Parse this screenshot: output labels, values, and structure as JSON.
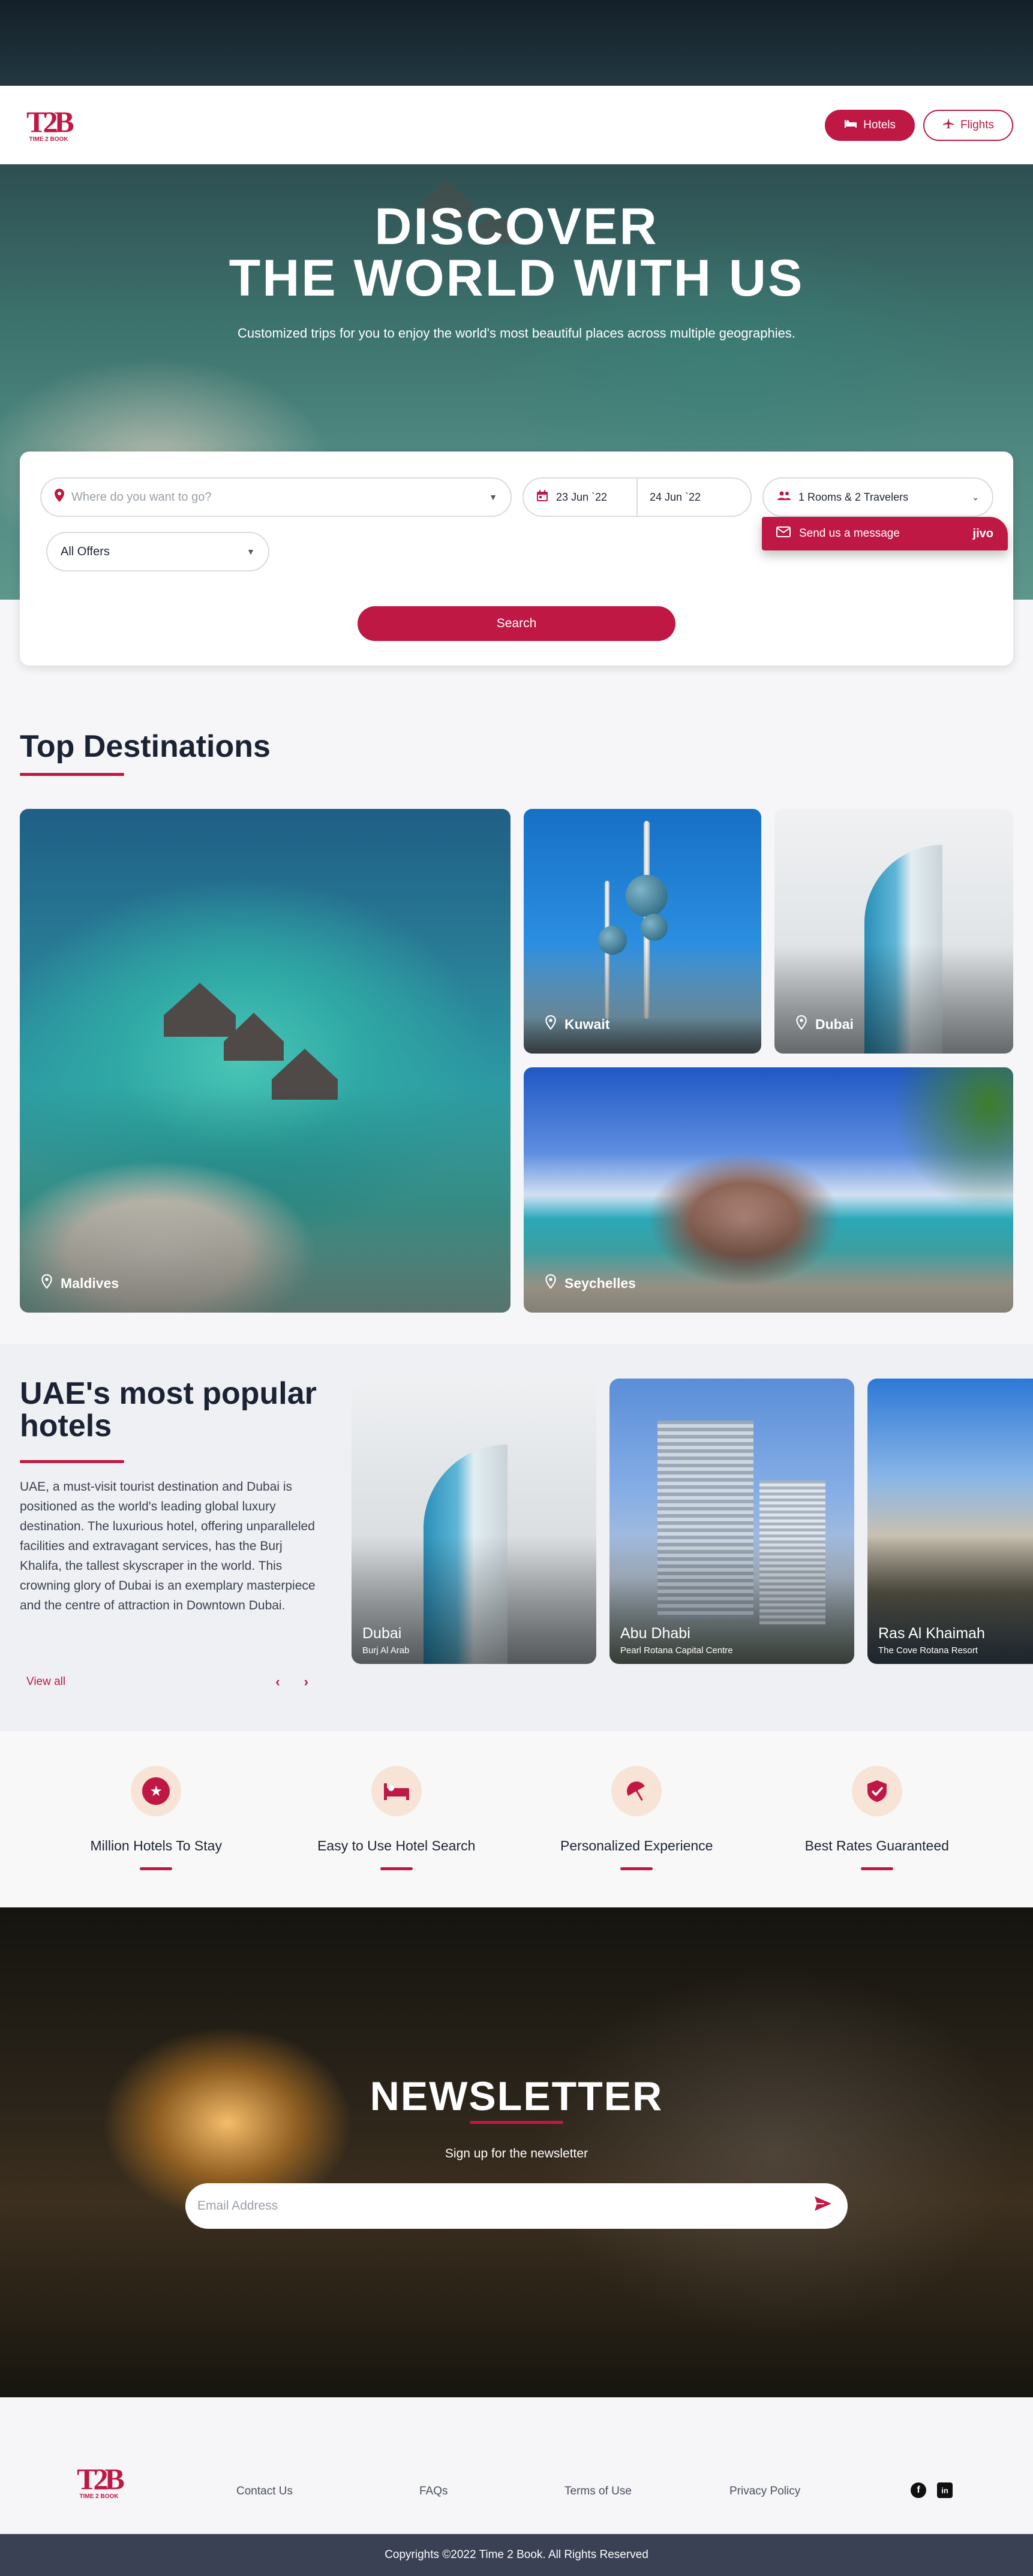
{
  "header": {
    "logo_mark": "T2B",
    "logo_text": "TIME 2 BOOK",
    "nav": [
      {
        "label": "Hotels",
        "icon": "bed-icon"
      },
      {
        "label": "Flights",
        "icon": "plane-icon"
      }
    ]
  },
  "hero": {
    "title_line1": "DISCOVER",
    "title_line2": "THE WORLD WITH US",
    "subtitle": "Customized trips for you to enjoy the world's most beautiful places across multiple geographies."
  },
  "search": {
    "destination_placeholder": "Where do you want to go?",
    "checkin": "23 Jun `22",
    "checkout": "24 Jun `22",
    "travelers": "1 Rooms & 2 Travelers",
    "offers": "All Offers",
    "search_label": "Search"
  },
  "chat": {
    "label": "Send us a message",
    "brand": "jivo"
  },
  "top_destinations": {
    "title": "Top Destinations",
    "items": [
      "Maldives",
      "Kuwait",
      "Dubai",
      "Seychelles"
    ]
  },
  "popular": {
    "title": "UAE's most popular hotels",
    "description": "UAE, a must-visit tourist destination and Dubai is positioned as the world's leading global luxury destination. The luxurious hotel, offering unparalleled facilities and extravagant services, has the Burj Khalifa, the tallest skyscraper in the world. This crowning glory of Dubai is an exemplary masterpiece and the centre of attraction in Downtown Dubai.",
    "view_all": "View all",
    "hotels": [
      {
        "city": "Dubai",
        "name": "Burj Al Arab"
      },
      {
        "city": "Abu Dhabi",
        "name": "Pearl Rotana Capital Centre"
      },
      {
        "city": "Ras Al Khaimah",
        "name": "The Cove Rotana Resort"
      }
    ]
  },
  "features": [
    {
      "label": "Million Hotels To Stay",
      "icon": "star-badge-icon"
    },
    {
      "label": "Easy to Use Hotel Search",
      "icon": "bed-icon"
    },
    {
      "label": "Personalized Experience",
      "icon": "umbrella-icon"
    },
    {
      "label": "Best Rates Guaranteed",
      "icon": "shield-check-icon"
    }
  ],
  "newsletter": {
    "title": "NEWSLETTER",
    "subtitle": "Sign up for the newsletter",
    "placeholder": "Email Address"
  },
  "footer": {
    "links": [
      "Contact Us",
      "FAQs",
      "Terms of Use",
      "Privacy Policy"
    ],
    "social": [
      "facebook-icon",
      "linkedin-icon"
    ],
    "copyright": "Copyrights ©2022 Time 2 Book. All Rights Reserved"
  },
  "colors": {
    "accent": "#bf1844",
    "dark": "#1a2233",
    "footer_bar": "#3a4154"
  }
}
